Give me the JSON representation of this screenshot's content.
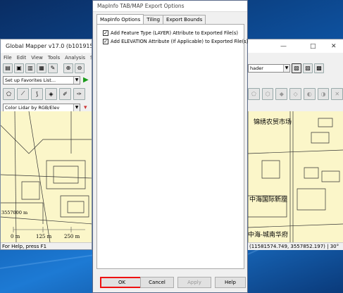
{
  "main_window": {
    "title": "Global Mapper v17.0 (b101915) [+",
    "menu": [
      "File",
      "Edit",
      "View",
      "Tools",
      "Analysis",
      "Se"
    ],
    "favorites_combo": "Set up Favorites List...",
    "shader_combo": "Color Lidar by RGB/Elev",
    "right_shader_combo": "hader",
    "scale_labels": [
      "0 m",
      "125 m",
      "250 m"
    ],
    "coordinate_label": "3557000 m",
    "status_left": "For Help, press F1",
    "status_right": "(11581574.749, 3557852.197) | 30°",
    "map_labels": [
      "锦绣农贸市场",
      "中海国际新座",
      "中海-城南华府"
    ]
  },
  "dialog": {
    "title": "MapInfo TAB/MAP Export Options",
    "tabs": [
      "MapInfo Options",
      "Tiling",
      "Export Bounds"
    ],
    "options": [
      {
        "label": "Add Feature Type (LAYER) Attribute to Exported File(s)",
        "checked": true
      },
      {
        "label": "Add ELEVATION Attribute (If Applicable) to Exported File(s)",
        "checked": true
      }
    ],
    "buttons": {
      "ok": "OK",
      "cancel": "Cancel",
      "apply": "Apply",
      "help": "Help"
    }
  },
  "window_controls": {
    "minimize": "—",
    "maximize": "□",
    "close": "✕"
  },
  "colors": {
    "map_background": "#fbf6c9",
    "ok_highlight": "#ee1111"
  }
}
